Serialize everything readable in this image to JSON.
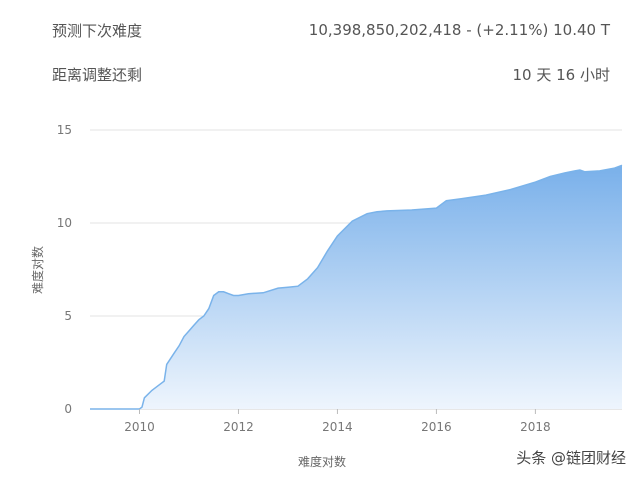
{
  "stats": {
    "next_difficulty_label": "预测下次难度",
    "next_difficulty_value": "10,398,850,202,418 - (+2.11%) 10.40 T",
    "remaining_label": "距离调整还剩",
    "remaining_value": "10 天 16 小时"
  },
  "watermark": "头条 @链团财经",
  "chart_data": {
    "type": "area",
    "title": "",
    "xlabel": "难度对数",
    "ylabel": "难度对数",
    "xlim": [
      2009.0,
      2019.75
    ],
    "ylim": [
      0,
      15
    ],
    "xticks": [
      2010,
      2012,
      2014,
      2016,
      2018
    ],
    "yticks": [
      0,
      5,
      10,
      15
    ],
    "grid": "horizontal",
    "color": "#7ab3ea",
    "series": [
      {
        "x": [
          2009.0,
          2010.0,
          2010.05,
          2010.1,
          2010.25,
          2010.35,
          2010.5,
          2010.55,
          2010.7,
          2010.8,
          2010.9,
          2011.0,
          2011.1,
          2011.2,
          2011.3,
          2011.4,
          2011.5,
          2011.6,
          2011.7,
          2011.8,
          2011.9,
          2012.0,
          2012.2,
          2012.5,
          2012.8,
          2013.0,
          2013.2,
          2013.4,
          2013.6,
          2013.8,
          2014.0,
          2014.3,
          2014.6,
          2014.8,
          2015.0,
          2015.5,
          2016.0,
          2016.2,
          2016.5,
          2017.0,
          2017.5,
          2018.0,
          2018.3,
          2018.6,
          2018.8,
          2018.9,
          2019.0,
          2019.3,
          2019.6,
          2019.75
        ],
        "y": [
          0.0,
          0.0,
          0.1,
          0.6,
          1.0,
          1.2,
          1.5,
          2.4,
          3.0,
          3.4,
          3.9,
          4.2,
          4.5,
          4.8,
          5.0,
          5.4,
          6.1,
          6.3,
          6.3,
          6.2,
          6.1,
          6.1,
          6.2,
          6.25,
          6.5,
          6.55,
          6.6,
          7.0,
          7.6,
          8.5,
          9.3,
          10.1,
          10.5,
          10.6,
          10.65,
          10.7,
          10.8,
          11.2,
          11.3,
          11.5,
          11.8,
          12.2,
          12.5,
          12.7,
          12.8,
          12.85,
          12.75,
          12.8,
          12.95,
          13.1
        ]
      }
    ]
  }
}
